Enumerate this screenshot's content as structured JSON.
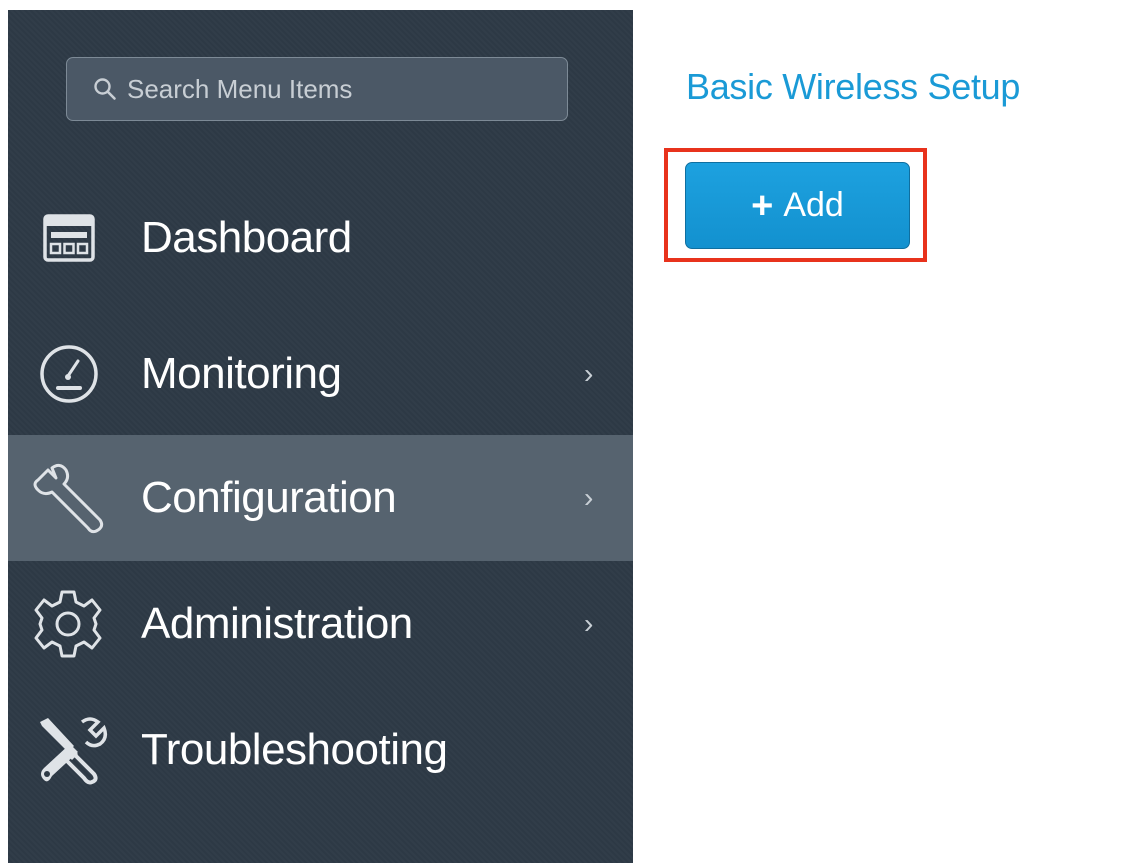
{
  "sidebar": {
    "search": {
      "placeholder": "Search Menu Items",
      "icon": "search-icon"
    },
    "items": [
      {
        "label": "Dashboard",
        "icon": "dashboard-icon",
        "has_submenu": false,
        "active": false
      },
      {
        "label": "Monitoring",
        "icon": "gauge-icon",
        "has_submenu": true,
        "active": false,
        "chevron": "›"
      },
      {
        "label": "Configuration",
        "icon": "wrench-icon",
        "has_submenu": true,
        "active": true,
        "chevron": "›"
      },
      {
        "label": "Administration",
        "icon": "gear-icon",
        "has_submenu": true,
        "active": false,
        "chevron": "›"
      },
      {
        "label": "Troubleshooting",
        "icon": "tools-icon",
        "has_submenu": false,
        "active": false
      }
    ]
  },
  "main": {
    "title": "Basic Wireless Setup",
    "add_button": {
      "plus": "+",
      "label": "Add"
    }
  },
  "colors": {
    "sidebar_bg": "#2e3a46",
    "active_item_bg": "#56636f",
    "accent_blue": "#1a9ad6",
    "button_blue": "#1a9ad6",
    "highlight_red": "#e8321c"
  }
}
